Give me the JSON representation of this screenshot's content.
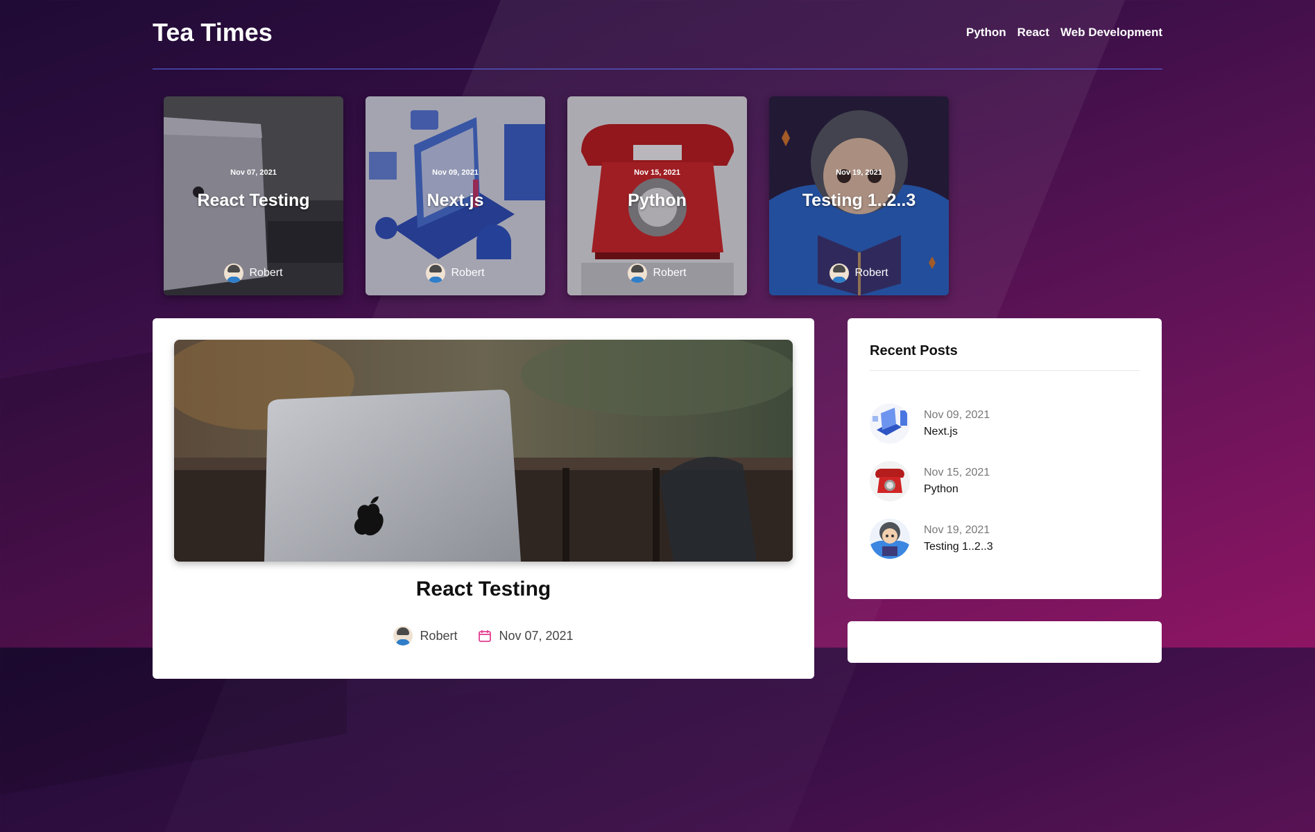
{
  "site": {
    "title": "Tea Times"
  },
  "nav": {
    "items": [
      "Python",
      "React",
      "Web Development"
    ]
  },
  "featured": [
    {
      "date": "Nov 07, 2021",
      "title": "React Testing",
      "author": "Robert",
      "art": "laptop"
    },
    {
      "date": "Nov 09, 2021",
      "title": "Next.js",
      "author": "Robert",
      "art": "isometric-web"
    },
    {
      "date": "Nov 15, 2021",
      "title": "Python",
      "author": "Robert",
      "art": "red-telephone"
    },
    {
      "date": "Nov 19, 2021",
      "title": "Testing 1..2..3",
      "author": "Robert",
      "art": "coder-avatar"
    }
  ],
  "post": {
    "title": "React Testing",
    "author": "Robert",
    "date": "Nov 07, 2021"
  },
  "sidebar": {
    "title": "Recent Posts",
    "items": [
      {
        "date": "Nov 09, 2021",
        "title": "Next.js",
        "thumb": "isometric-web"
      },
      {
        "date": "Nov 15, 2021",
        "title": "Python",
        "thumb": "red-telephone"
      },
      {
        "date": "Nov 19, 2021",
        "title": "Testing 1..2..3",
        "thumb": "coder-avatar"
      }
    ]
  },
  "colors": {
    "accent": "#e23d8f",
    "divider": "#5a6cf0"
  }
}
